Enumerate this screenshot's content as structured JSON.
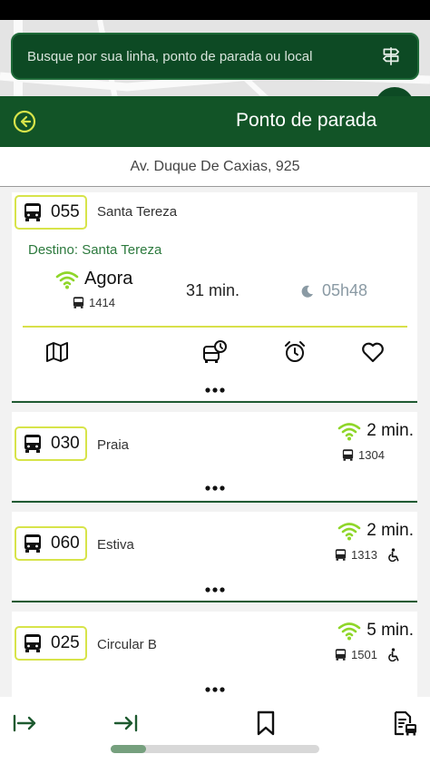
{
  "search": {
    "placeholder": "Busque por sua linha, ponto de parada ou local"
  },
  "header": {
    "title": "Ponto de parada"
  },
  "stop": {
    "address": "Av. Duque De Caxias, 925"
  },
  "colors": {
    "brand_green": "#125427",
    "accent_yellow": "#d7e44a",
    "signal_green": "#8fd62a",
    "destino_green": "#2d7a3e"
  },
  "arrivals": [
    {
      "route": "055",
      "name": "Santa Tereza",
      "destino": "Destino: Santa Tereza",
      "status": "Agora",
      "vehicle": "1414",
      "next_time": "31 min.",
      "night_time": "05h48",
      "actions": [
        "map-icon",
        "bus-schedule-icon",
        "alarm-icon",
        "heart-icon"
      ]
    },
    {
      "route": "030",
      "name": "Praia",
      "time": "2 min.",
      "vehicle": "1304",
      "accessible": false
    },
    {
      "route": "060",
      "name": "Estiva",
      "time": "2 min.",
      "vehicle": "1313",
      "accessible": true
    },
    {
      "route": "025",
      "name": "Circular B",
      "time": "5 min.",
      "vehicle": "1501",
      "accessible": true
    }
  ],
  "bottom_nav": [
    "arrow-right-bar-icon",
    "arrow-to-end-icon",
    "bookmark-icon",
    "document-bus-icon"
  ],
  "scroll": {
    "position": 0.17
  }
}
